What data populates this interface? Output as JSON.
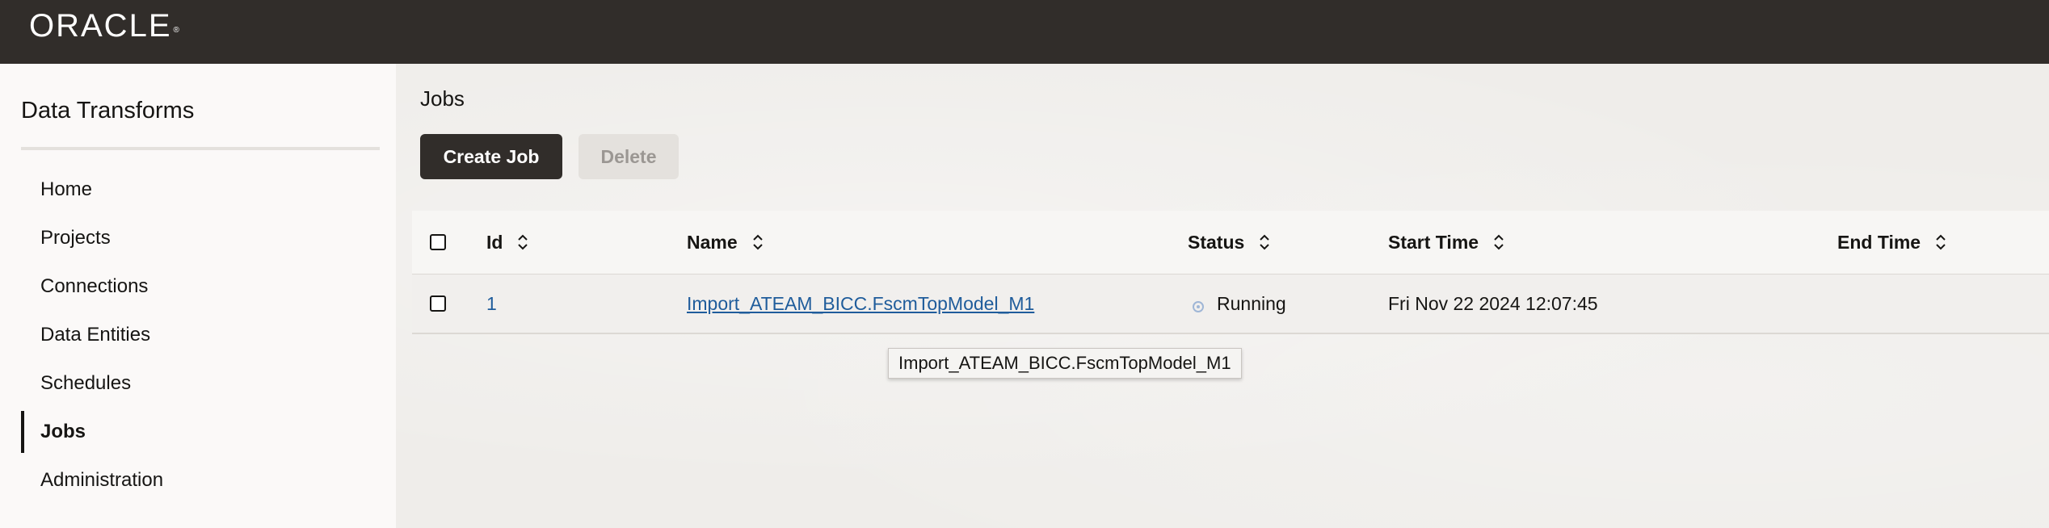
{
  "header": {
    "logo_text": "ORACLE",
    "logo_mark": "®"
  },
  "sidebar": {
    "title": "Data Transforms",
    "items": [
      {
        "label": "Home"
      },
      {
        "label": "Projects"
      },
      {
        "label": "Connections"
      },
      {
        "label": "Data Entities"
      },
      {
        "label": "Schedules"
      },
      {
        "label": "Jobs",
        "active": true
      },
      {
        "label": "Administration"
      }
    ]
  },
  "main": {
    "title": "Jobs",
    "buttons": {
      "create": "Create Job",
      "delete": "Delete"
    },
    "table": {
      "columns": [
        "Id",
        "Name",
        "Status",
        "Start Time",
        "End Time"
      ],
      "rows": [
        {
          "id": "1",
          "name": "Import_ATEAM_BICC.FscmTopModel_M1",
          "status": "Running",
          "start_time": "Fri Nov 22 2024 12:07:45",
          "end_time": ""
        }
      ]
    },
    "tooltip": "Import_ATEAM_BICC.FscmTopModel_M1"
  },
  "colors": {
    "header_bg": "#312d2a",
    "primary_button": "#312d2a",
    "link": "#1f5c9b",
    "status_running": "#9fb6d6"
  }
}
